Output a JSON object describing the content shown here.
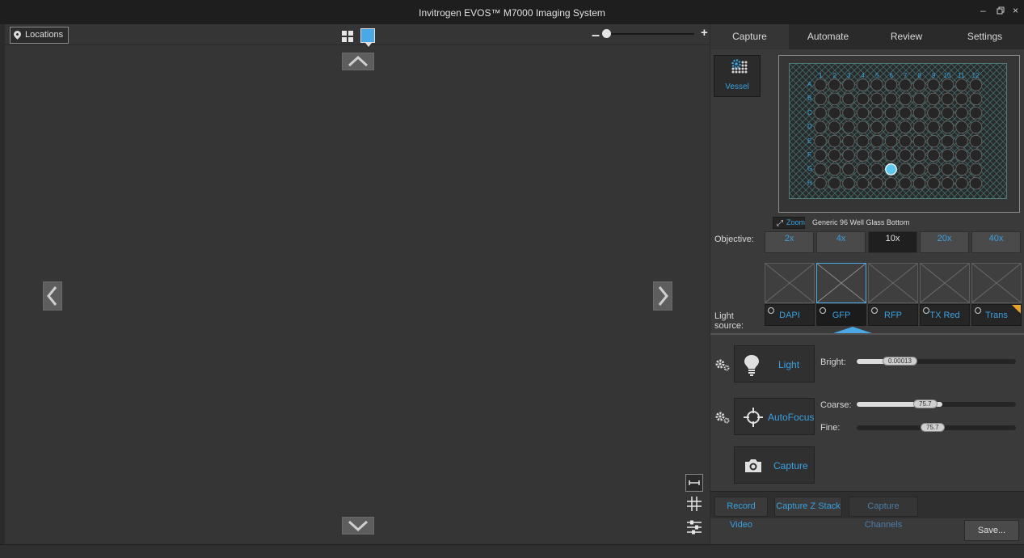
{
  "window": {
    "title": "Invitrogen EVOS™ M7000 Imaging System",
    "controls": {
      "minimize": "–",
      "restore": "🗗",
      "close": "×"
    }
  },
  "toolbar": {
    "locations_label": "Locations",
    "zoom_minus": "–",
    "zoom_plus": "+",
    "zoom_level": 0.03
  },
  "tabs": [
    {
      "label": "Capture",
      "active": true
    },
    {
      "label": "Automate",
      "active": false
    },
    {
      "label": "Review",
      "active": false
    },
    {
      "label": "Settings",
      "active": false
    }
  ],
  "vessel": {
    "button_label": "Vessel",
    "zoom_label": "Zoom",
    "name": "Generic 96 Well Glass Bottom",
    "columns": [
      "1",
      "2",
      "3",
      "4",
      "5",
      "6",
      "7",
      "8",
      "9",
      "10",
      "11",
      "12"
    ],
    "rows": [
      "A",
      "B",
      "C",
      "D",
      "E",
      "F",
      "G",
      "H"
    ],
    "selected_well": {
      "row": "G",
      "column": "6"
    }
  },
  "objective": {
    "label": "Objective:",
    "options": [
      "2x",
      "4x",
      "10x",
      "20x",
      "40x"
    ],
    "selected": "10x"
  },
  "light_source": {
    "label_line1": "Light",
    "label_line2": "source:",
    "options": [
      "DAPI",
      "GFP",
      "RFP",
      "TX Red",
      "Trans"
    ],
    "selected": "GFP",
    "trans_badge": "B"
  },
  "controls": {
    "light_button": "Light",
    "autofocus_button": "AutoFocus",
    "capture_button": "Capture",
    "bright_label": "Bright:",
    "bright_value": "0.00013",
    "bright_fill": 0.34,
    "coarse_label": "Coarse:",
    "coarse_value": "75.7",
    "coarse_fill": 0.54,
    "fine_label": "Fine:",
    "fine_value": "75.7",
    "fine_fill": 0.54
  },
  "bottom": {
    "record_video": "Record Video",
    "capture_z_stack": "Capture Z Stack",
    "capture_channels": "Capture Channels",
    "save": "Save..."
  },
  "colors": {
    "accent": "#3aa0e0",
    "selected_well": "#5ec8ee",
    "plate_grid": "#4d7a78",
    "trans_badge": "#e8a22b"
  }
}
